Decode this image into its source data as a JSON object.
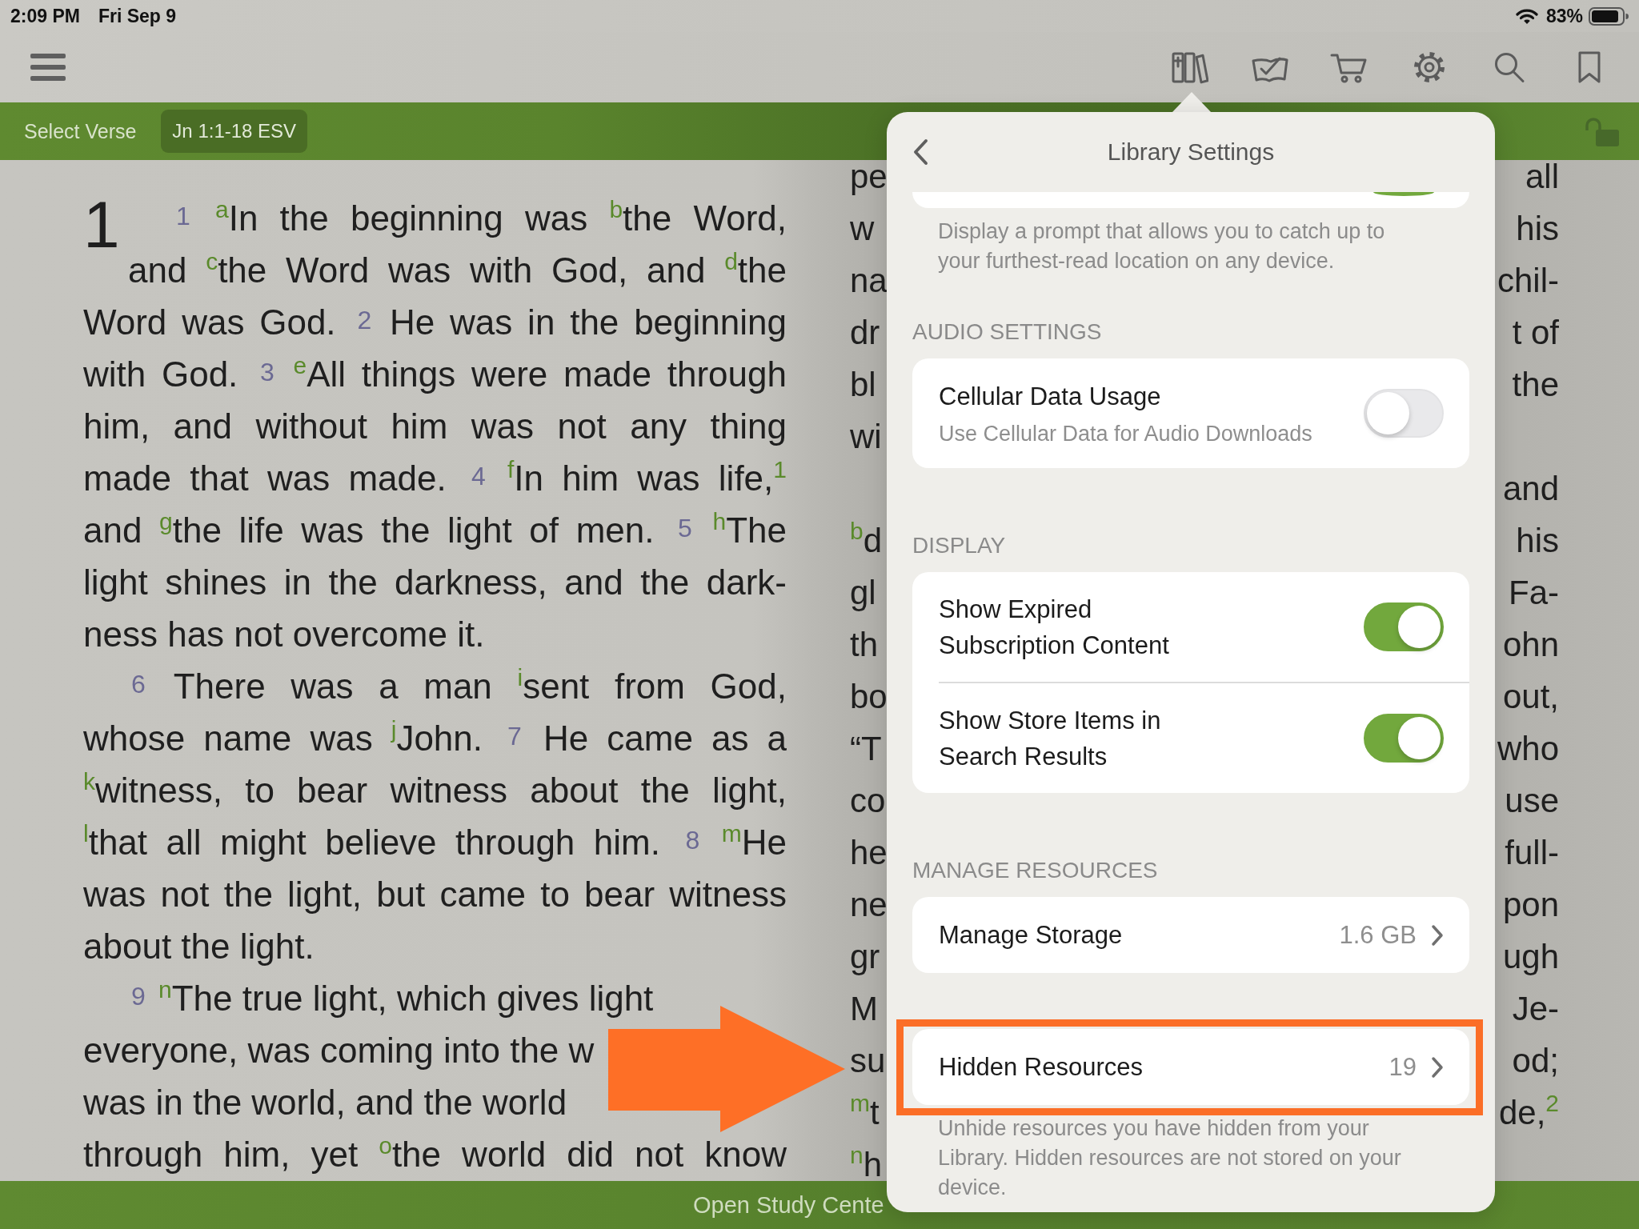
{
  "status_bar": {
    "time": "2:09 PM",
    "date": "Fri Sep 9",
    "battery": "83%"
  },
  "verse_bar": {
    "label": "Select Verse",
    "reference": "Jn 1:1-18 ESV"
  },
  "reader": {
    "left_page": {
      "chapter": "1",
      "paragraphs": [
        {
          "continues": false,
          "lines": [
            {
              "covered": false,
              "parts": [
                {
                  "kind": "verse",
                  "text": "1"
                },
                {
                  "kind": "text",
                  "text": "$^{a}$In the beginning was $^{b}$the Word,"
                }
              ]
            },
            {
              "covered": false,
              "parts": [
                {
                  "kind": "text",
                  "text": "and $^{c}$the Word was with God, and $^{d}$the"
                }
              ]
            },
            {
              "covered": false,
              "parts": [
                {
                  "kind": "text",
                  "text": "Word was God."
                },
                {
                  "kind": "verse",
                  "text": "2"
                },
                {
                  "kind": "text",
                  "text": "He was in the beginning"
                }
              ]
            },
            {
              "covered": false,
              "parts": [
                {
                  "kind": "text",
                  "text": "with God."
                },
                {
                  "kind": "verse",
                  "text": "3"
                },
                {
                  "kind": "text",
                  "text": "$^{e}$All things were made through"
                }
              ]
            },
            {
              "covered": false,
              "parts": [
                {
                  "kind": "text",
                  "text": "him, and without him was not any thing"
                }
              ]
            },
            {
              "covered": false,
              "parts": [
                {
                  "kind": "text",
                  "text": "made that was made."
                },
                {
                  "kind": "verse",
                  "text": "4"
                },
                {
                  "kind": "text",
                  "text": "$^{f}$In him was life,$^{1}$"
                }
              ]
            },
            {
              "covered": false,
              "parts": [
                {
                  "kind": "text",
                  "text": "and $^{g}$the life was the light of men."
                },
                {
                  "kind": "verse",
                  "text": "5"
                },
                {
                  "kind": "text",
                  "text": "$^{h}$The"
                }
              ]
            },
            {
              "covered": false,
              "parts": [
                {
                  "kind": "text",
                  "text": "light shines in the darkness, and the dark-"
                }
              ]
            },
            {
              "covered": false,
              "parts": [
                {
                  "kind": "text",
                  "text": "ness has not overcome it."
                }
              ]
            }
          ]
        },
        {
          "continues": false,
          "lines": [
            {
              "covered": false,
              "parts": [
                {
                  "kind": "verse",
                  "text": "6"
                },
                {
                  "kind": "text",
                  "text": "There was a man $^{i}$sent from God,"
                }
              ]
            },
            {
              "covered": false,
              "parts": [
                {
                  "kind": "text",
                  "text": "whose name was $^{j}$John."
                },
                {
                  "kind": "verse",
                  "text": "7"
                },
                {
                  "kind": "text",
                  "text": "He came as a"
                }
              ]
            },
            {
              "covered": false,
              "parts": [
                {
                  "kind": "text",
                  "text": "$^{k}$witness, to bear witness about the light,"
                }
              ]
            },
            {
              "covered": false,
              "parts": [
                {
                  "kind": "text",
                  "text": "$^{l}$that all might believe through him."
                },
                {
                  "kind": "verse",
                  "text": "8"
                },
                {
                  "kind": "text",
                  "text": "$^{m}$He"
                }
              ]
            },
            {
              "covered": false,
              "parts": [
                {
                  "kind": "text",
                  "text": "was not the light, but came to bear witness"
                }
              ]
            },
            {
              "covered": false,
              "parts": [
                {
                  "kind": "text",
                  "text": "about the light."
                }
              ]
            }
          ]
        },
        {
          "continues": true,
          "lines": [
            {
              "covered": true,
              "parts": [
                {
                  "kind": "verse",
                  "text": "9"
                },
                {
                  "kind": "text",
                  "text": "$^{n}$The true light, which gives light"
                }
              ]
            },
            {
              "covered": true,
              "parts": [
                {
                  "kind": "text",
                  "text": "everyone, was coming into the w"
                }
              ]
            },
            {
              "covered": true,
              "parts": [
                {
                  "kind": "text",
                  "text": "was in the world, and the world"
                }
              ]
            },
            {
              "covered": false,
              "parts": [
                {
                  "kind": "text",
                  "text": "through him, yet $^{o}$the world did not know"
                }
              ]
            }
          ]
        }
      ]
    },
    "right_page": {
      "lines": [
        {
          "start": "pe",
          "end": "all"
        },
        {
          "start": "w",
          "end": "his"
        },
        {
          "start": "na",
          "end": "chil-"
        },
        {
          "start": "dr",
          "end": "t of"
        },
        {
          "start": "bl",
          "end": "the"
        },
        {
          "start": "wi"
        },
        {
          "end": "and"
        },
        {
          "start": "$^{b}$d",
          "end": "his"
        },
        {
          "start": "gl",
          "end": "Fa-"
        },
        {
          "start": "th",
          "end": "ohn"
        },
        {
          "start": "bo",
          "end": "out,"
        },
        {
          "start": "“T",
          "end": "who"
        },
        {
          "start": "co",
          "end": "use"
        },
        {
          "start": "he",
          "end": "full-"
        },
        {
          "start": "ne",
          "end": "pon"
        },
        {
          "start": "gr",
          "end": "ugh"
        },
        {
          "start": "M",
          "end": "Je-"
        },
        {
          "start": "su",
          "end": "od;"
        },
        {
          "start": "$^{m}$t",
          "end": "de,$^{2}$"
        },
        {
          "start": "$^{n}$h"
        }
      ]
    }
  },
  "popover": {
    "title": "Library Settings",
    "sections": [
      {
        "highlighted": false,
        "items": [
          {
            "kind": "toggle",
            "on": true
          }
        ],
        "footer": "Display a prompt that allows you to catch up to your furthest-read location on any device."
      },
      {
        "header": "AUDIO SETTINGS",
        "highlighted": false,
        "items": [
          {
            "kind": "toggle",
            "label": "Cellular Data Usage",
            "detail": "Use Cellular Data for Audio Downloads",
            "on": false
          }
        ]
      },
      {
        "header": "DISPLAY",
        "highlighted": false,
        "items": [
          {
            "kind": "toggle",
            "label": "Show Expired Subscription Content",
            "on": true
          },
          {
            "kind": "toggle",
            "label": "Show Store Items in Search Results",
            "on": true
          }
        ]
      },
      {
        "header": "MANAGE RESOURCES",
        "highlighted": false,
        "items": [
          {
            "kind": "link",
            "label": "Manage Storage",
            "value": "1.6 GB"
          }
        ]
      },
      {
        "highlighted": true,
        "items": [
          {
            "kind": "link",
            "label": "Hidden Resources",
            "value": "19"
          }
        ],
        "footer": "Unhide resources you have hidden from your Library. Hidden resources are not stored on your device."
      }
    ]
  },
  "bottom_bar": {
    "label": "Open Study Cente"
  }
}
